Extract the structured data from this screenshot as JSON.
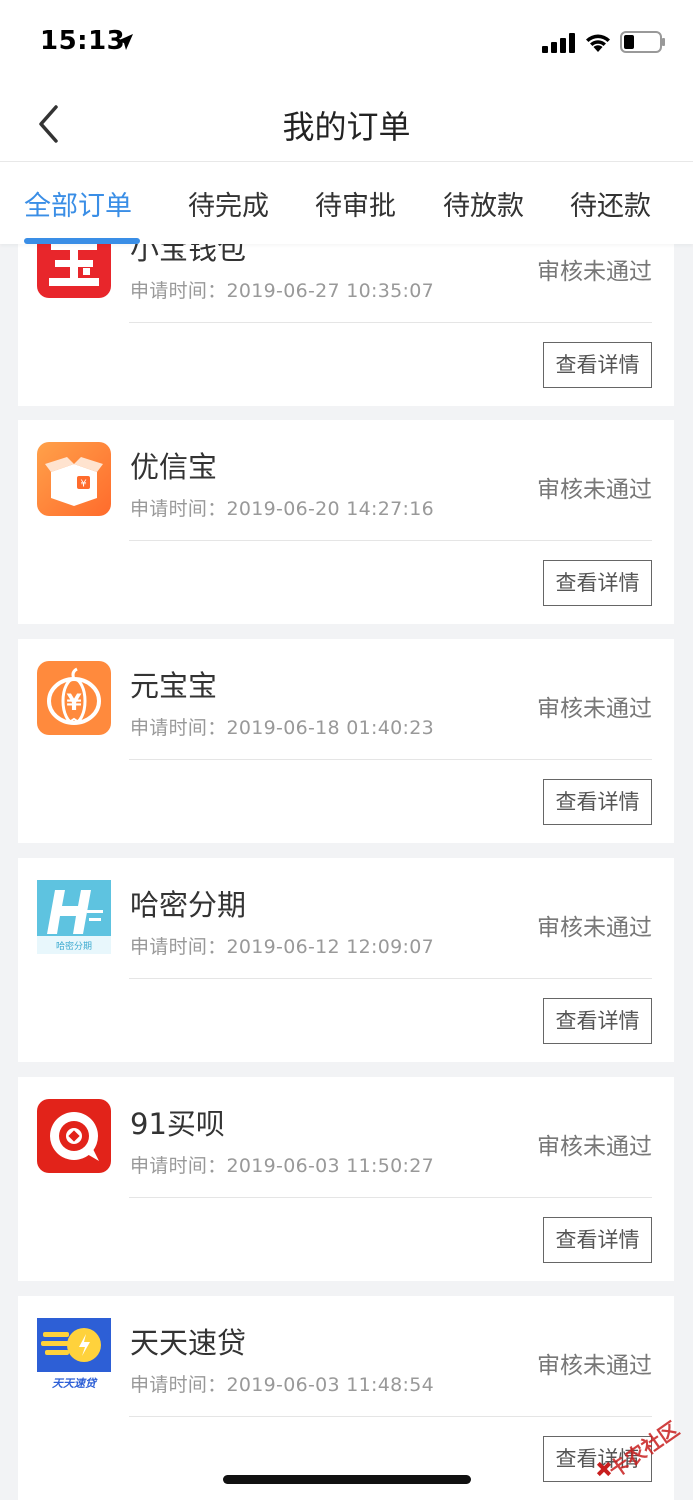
{
  "status_bar": {
    "time": "15:13"
  },
  "nav": {
    "title": "我的订单"
  },
  "tabs": [
    {
      "label": "全部订单",
      "active": true
    },
    {
      "label": "待完成",
      "active": false
    },
    {
      "label": "待审批",
      "active": false
    },
    {
      "label": "待放款",
      "active": false
    },
    {
      "label": "待还款",
      "active": false
    }
  ],
  "orders": [
    {
      "name": "小宝钱包",
      "time": "申请时间：2019-06-27 10:35:07",
      "status": "审核未通过",
      "button": "查看详情",
      "logo": "xiaobao-logo"
    },
    {
      "name": "优信宝",
      "time": "申请时间：2019-06-20 14:27:16",
      "status": "审核未通过",
      "button": "查看详情",
      "logo": "youxinbao-logo"
    },
    {
      "name": "元宝宝",
      "time": "申请时间：2019-06-18 01:40:23",
      "status": "审核未通过",
      "button": "查看详情",
      "logo": "yuanbaobao-logo"
    },
    {
      "name": "哈密分期",
      "time": "申请时间：2019-06-12 12:09:07",
      "status": "审核未通过",
      "button": "查看详情",
      "logo": "hami-logo",
      "logo_text": "哈密分期"
    },
    {
      "name": "91买呗",
      "time": "申请时间：2019-06-03 11:50:27",
      "status": "审核未通过",
      "button": "查看详情",
      "logo": "91maibei-logo"
    },
    {
      "name": "天天速贷",
      "time": "申请时间：2019-06-03 11:48:54",
      "status": "审核未通过",
      "button": "查看详情",
      "logo": "tiantian-logo",
      "logo_text": "天天速贷"
    }
  ],
  "watermark": {
    "text": "卡农社区"
  },
  "colors": {
    "accent": "#3a8ee6",
    "status_text": "#777777",
    "background": "#f2f3f5"
  }
}
